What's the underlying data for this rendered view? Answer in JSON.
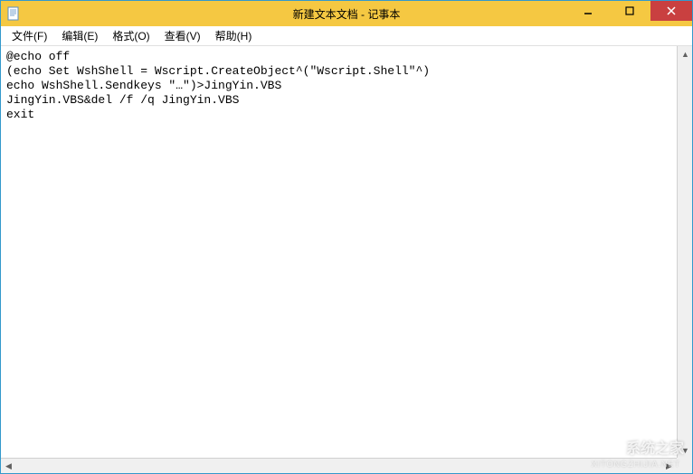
{
  "titlebar": {
    "title": "新建文本文档 - 记事本"
  },
  "menubar": {
    "items": [
      {
        "label": "文件(F)"
      },
      {
        "label": "编辑(E)"
      },
      {
        "label": "格式(O)"
      },
      {
        "label": "查看(V)"
      },
      {
        "label": "帮助(H)"
      }
    ]
  },
  "content": {
    "text": "@echo off\n(echo Set WshShell = Wscript.CreateObject^(\"Wscript.Shell\"^)\necho WshShell.Sendkeys \"…\")>JingYin.VBS\nJingYin.VBS&del /f /q JingYin.VBS\nexit"
  },
  "watermark": {
    "main": "系统之家",
    "sub": "XITONGZHIJIA.NET"
  }
}
